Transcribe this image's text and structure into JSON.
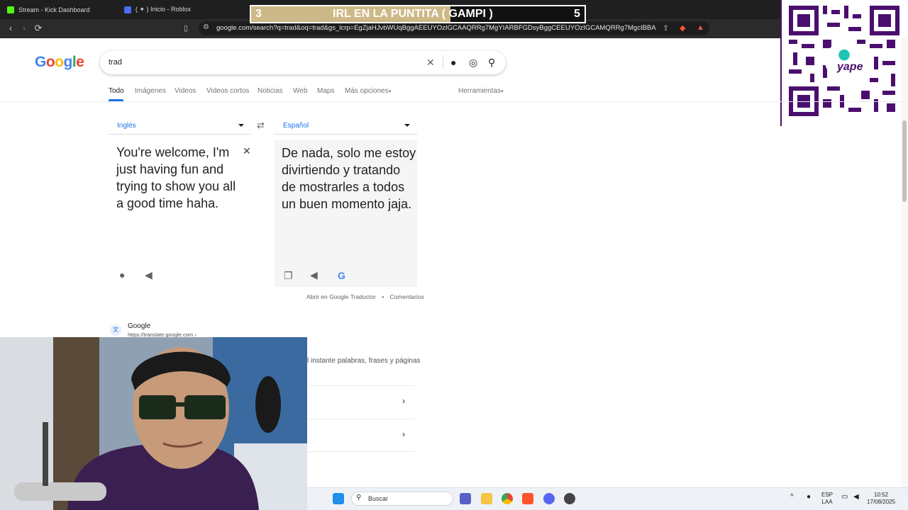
{
  "browser": {
    "tabs": [
      {
        "label": "Stream - Kick Dashboard"
      },
      {
        "label": "( ✦ ) Inicio - Roblox"
      }
    ],
    "url": "google.com/search?q=trad&oq=trad&gs_lcrp=EgZjaHJvbWUqBggAEEUYOzIGCAAQRRg7MgYIARBFGDsyBggCEEUYOzIGCAMQRRg7MgcIBBAAGI8C..."
  },
  "overlay": {
    "left_number": "3",
    "title": "IRL EN LA PUNTITA ( GAMPI )",
    "right_number": "5",
    "qr_brand": "yape"
  },
  "google": {
    "logo": "Google",
    "query": "trad",
    "tabs": [
      "Todo",
      "Imágenes",
      "Videos",
      "Videos cortos",
      "Noticias",
      "Web",
      "Maps",
      "Más opciones"
    ],
    "tools": "Herramientas"
  },
  "translate": {
    "source_lang": "Inglés",
    "target_lang": "Español",
    "source_text": "You're welcome, I'm just having fun and trying to show you all a good time haha.",
    "target_text": "De nada, solo me estoy divirtiendo y tratando de mostrarles a todos un buen momento jaja.",
    "open_link": "Abrir en Google Traductor",
    "feedback_link": "Comentarios",
    "separator": "•"
  },
  "result": {
    "source": "Google",
    "url": "https://translate.google.com ›",
    "snippet": "l instante palabras, frases y páginas"
  },
  "taskbar": {
    "search_placeholder": "Buscar",
    "lang_top": "ESP",
    "lang_bottom": "LAA",
    "time": "10:52",
    "date": "17/08/2025"
  }
}
